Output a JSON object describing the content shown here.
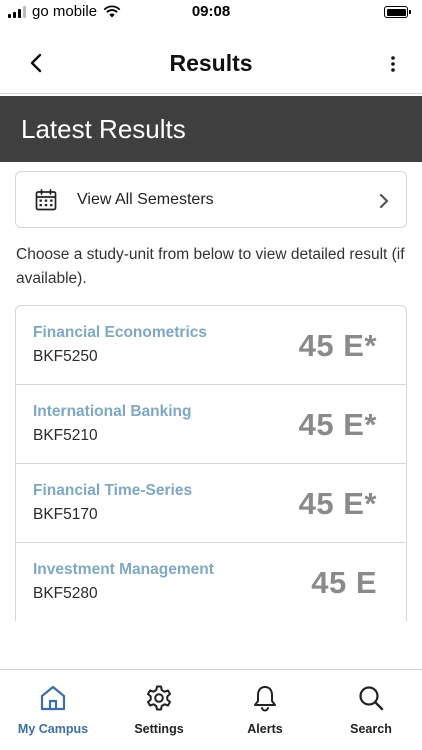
{
  "status_bar": {
    "carrier": "go mobile",
    "time": "09:08"
  },
  "nav": {
    "title": "Results",
    "back_icon": "chevron-left-icon",
    "more_icon": "vertical-ellipsis-icon"
  },
  "banner": {
    "title": "Latest Results"
  },
  "semester_selector": {
    "label": "View All Semesters",
    "icon": "calendar-icon"
  },
  "instructions": "Choose a study-unit from below to view detailed result (if available).",
  "results": [
    {
      "name": "Financial Econometrics",
      "code": "BKF5250",
      "grade": "45 E*"
    },
    {
      "name": "International Banking",
      "code": "BKF5210",
      "grade": "45 E*"
    },
    {
      "name": "Financial Time-Series",
      "code": "BKF5170",
      "grade": "45 E*"
    },
    {
      "name": "Investment Management",
      "code": "BKF5280",
      "grade": "45 E"
    }
  ],
  "tab_bar": {
    "active": "my_campus",
    "tabs": [
      {
        "id": "my_campus",
        "label": "My Campus",
        "icon": "home-icon"
      },
      {
        "id": "settings",
        "label": "Settings",
        "icon": "gear-icon"
      },
      {
        "id": "alerts",
        "label": "Alerts",
        "icon": "bell-icon"
      },
      {
        "id": "search",
        "label": "Search",
        "icon": "search-icon"
      }
    ]
  },
  "colors": {
    "banner_bg": "#3f3f3f",
    "course_name": "#7fa8c3",
    "grade": "#8a8a8a",
    "active_tab": "#3d6fa3"
  }
}
